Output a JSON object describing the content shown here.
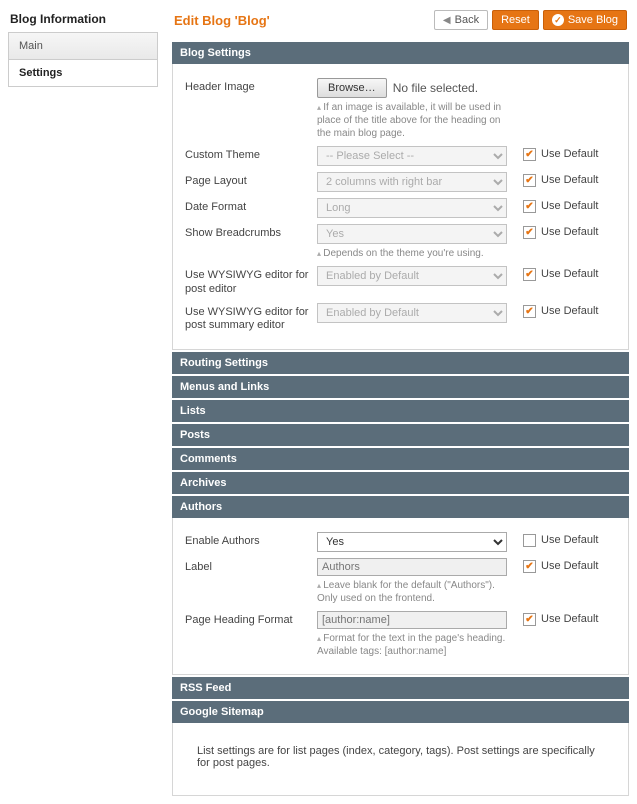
{
  "sidebar": {
    "title": "Blog Information",
    "tabs": {
      "main": "Main",
      "settings": "Settings"
    }
  },
  "header": {
    "title": "Edit Blog 'Blog'",
    "back": "Back",
    "reset": "Reset",
    "save": "Save Blog"
  },
  "sections": {
    "blog_settings": "Blog Settings",
    "routing": "Routing Settings",
    "menus": "Menus and Links",
    "lists": "Lists",
    "posts": "Posts",
    "comments": "Comments",
    "archives": "Archives",
    "authors": "Authors",
    "rss": "RSS Feed",
    "sitemap": "Google Sitemap"
  },
  "use_default_label": "Use Default",
  "blog": {
    "header_image": {
      "label": "Header Image",
      "browse": "Browse…",
      "status": "No file selected.",
      "hint": "If an image is available, it will be used in place of the title above for the heading on the main blog page."
    },
    "custom_theme": {
      "label": "Custom Theme",
      "value": "-- Please Select --"
    },
    "page_layout": {
      "label": "Page Layout",
      "value": "2 columns with right bar"
    },
    "date_format": {
      "label": "Date Format",
      "value": "Long"
    },
    "breadcrumbs": {
      "label": "Show Breadcrumbs",
      "value": "Yes",
      "hint": "Depends on the theme you're using."
    },
    "wysiwyg_post": {
      "label": "Use WYSIWYG editor for post editor",
      "value": "Enabled by Default"
    },
    "wysiwyg_summary": {
      "label": "Use WYSIWYG editor for post summary editor",
      "value": "Enabled by Default"
    }
  },
  "authors": {
    "enable": {
      "label": "Enable Authors",
      "value": "Yes"
    },
    "label_field": {
      "label": "Label",
      "placeholder": "Authors",
      "hint": "Leave blank for the default (\"Authors\"). Only used on the frontend."
    },
    "heading_format": {
      "label": "Page Heading Format",
      "placeholder": "[author:name]",
      "hint": "Format for the text in the page's heading. Available tags: [author:name]"
    }
  },
  "bottom_note": "List settings are for list pages (index, category, tags). Post settings are specifically for post pages."
}
